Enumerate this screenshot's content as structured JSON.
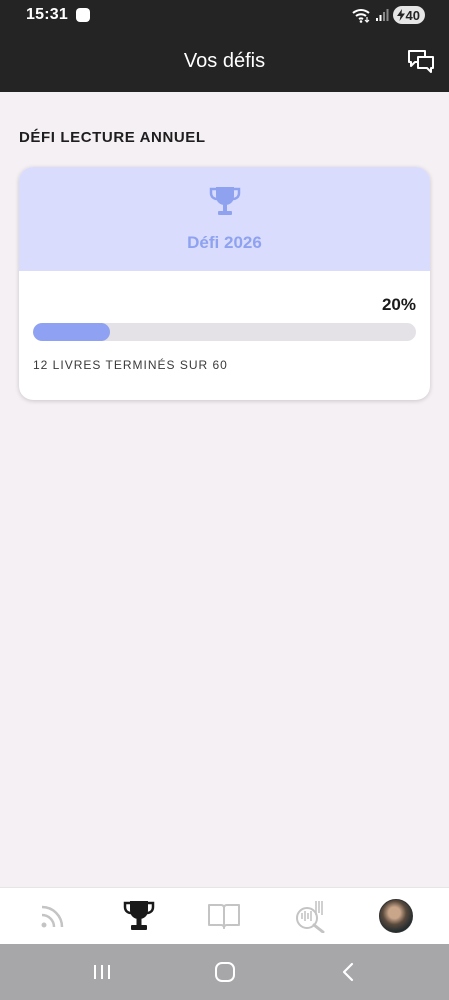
{
  "status_bar": {
    "time": "15:31",
    "battery_level": "40",
    "icons": [
      "wifi-icon",
      "signal-icon",
      "battery-charging-icon"
    ]
  },
  "header": {
    "title": "Vos défis",
    "action_icon": "chat-icon"
  },
  "section": {
    "title": "DÉFI LECTURE ANNUEL"
  },
  "challenge_card": {
    "icon": "trophy-icon",
    "title": "Défi 2026",
    "percent_label": "20%",
    "progress_fraction": 0.2,
    "caption": "12 LIVRES TERMINÉS SUR 60"
  },
  "tabs": [
    {
      "name": "feed",
      "icon": "rss-icon",
      "active": false
    },
    {
      "name": "challenges",
      "icon": "trophy-icon",
      "active": true
    },
    {
      "name": "library",
      "icon": "book-icon",
      "active": false
    },
    {
      "name": "search",
      "icon": "barcode-search-icon",
      "active": false
    },
    {
      "name": "profile",
      "icon": "avatar",
      "active": false
    }
  ],
  "colors": {
    "app_bar": "#242424",
    "background": "#f5f0f4",
    "card_header": "#d9dcfd",
    "accent": "#8fa1f2",
    "track": "#e4e2e6"
  },
  "system_nav": [
    "recent-apps-icon",
    "home-icon",
    "back-icon"
  ]
}
